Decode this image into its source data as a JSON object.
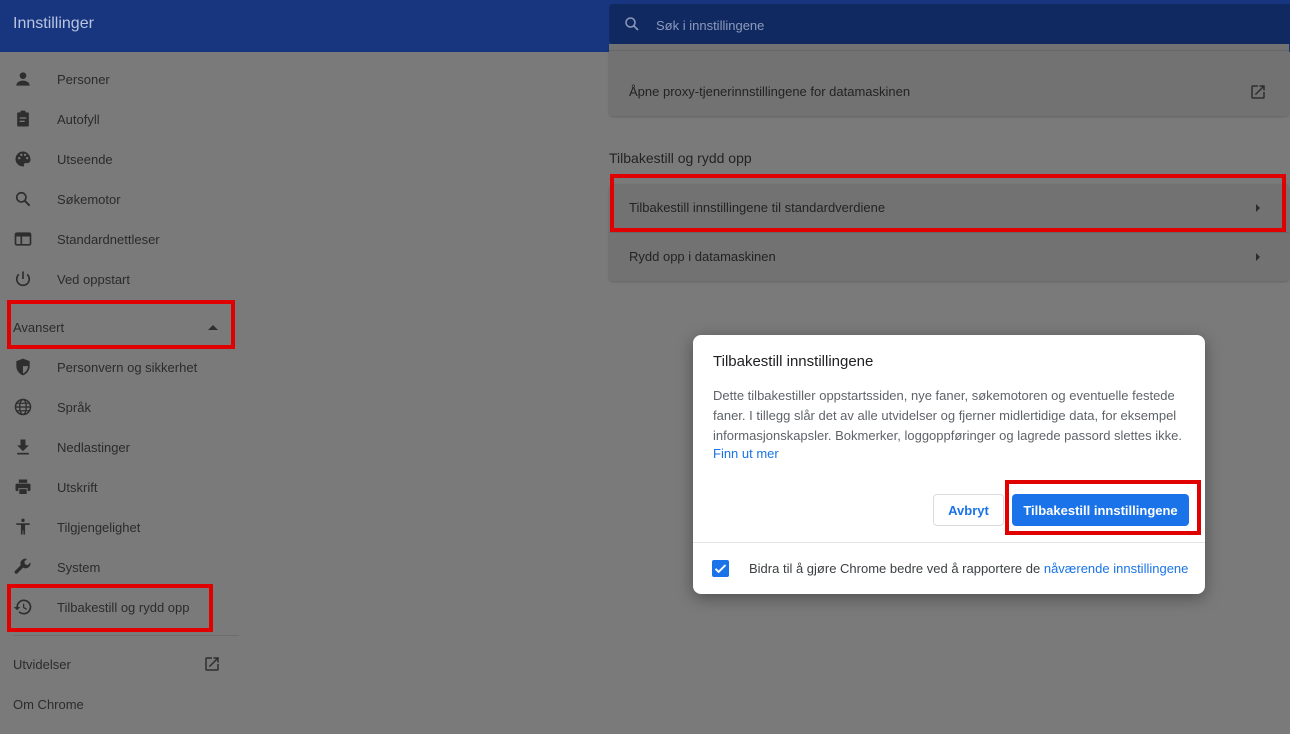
{
  "header": {
    "title": "Innstillinger",
    "search_placeholder": "Søk i innstillingene"
  },
  "sidebar": {
    "items": [
      {
        "label": "Personer",
        "icon": "person-icon"
      },
      {
        "label": "Autofyll",
        "icon": "clipboard-icon"
      },
      {
        "label": "Utseende",
        "icon": "palette-icon"
      },
      {
        "label": "Søkemotor",
        "icon": "search-icon"
      },
      {
        "label": "Standardnettleser",
        "icon": "browser-window-icon"
      },
      {
        "label": "Ved oppstart",
        "icon": "power-icon"
      }
    ],
    "advanced_label": "Avansert",
    "advanced_items": [
      {
        "label": "Personvern og sikkerhet",
        "icon": "shield-icon"
      },
      {
        "label": "Språk",
        "icon": "globe-icon"
      },
      {
        "label": "Nedlastinger",
        "icon": "download-icon"
      },
      {
        "label": "Utskrift",
        "icon": "printer-icon"
      },
      {
        "label": "Tilgjengelighet",
        "icon": "accessibility-icon"
      },
      {
        "label": "System",
        "icon": "wrench-icon"
      },
      {
        "label": "Tilbakestill og rydd opp",
        "icon": "restore-icon"
      }
    ],
    "extensions_label": "Utvidelser",
    "about_label": "Om Chrome"
  },
  "main": {
    "proxy_label": "Åpne proxy-tjenerinnstillingene for datamaskinen",
    "section_title": "Tilbakestill og rydd opp",
    "reset_row_label": "Tilbakestill innstillingene til standardverdiene",
    "cleanup_row_label": "Rydd opp i datamaskinen"
  },
  "dialog": {
    "title": "Tilbakestill innstillingene",
    "body": "Dette tilbakestiller oppstartssiden, nye faner, søkemotoren og eventuelle festede faner. I tillegg slår det av alle utvidelser og fjerner midlertidige data, for eksempel informasjonskapsler. Bokmerker, loggoppføringer og lagrede passord slettes ikke.",
    "learn_more": "Finn ut mer",
    "cancel": "Avbryt",
    "confirm": "Tilbakestill innstillingene",
    "checkbox_text": "Bidra til å gjøre Chrome bedre ved å rapportere de",
    "checkbox_link": "nåværende innstillingene",
    "checkbox_checked": true
  },
  "colors": {
    "header_bg": "#18367f",
    "accent": "#1a73e8",
    "highlight": "#e00000"
  }
}
